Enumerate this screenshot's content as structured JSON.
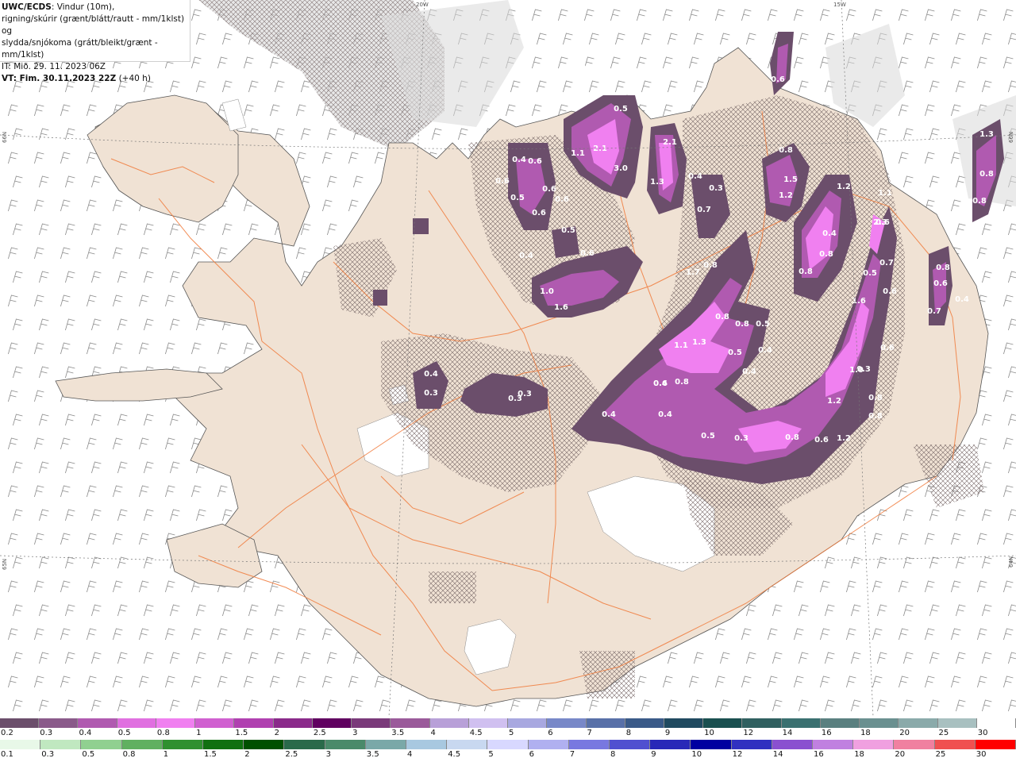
{
  "header": {
    "title_bold": "UWC/ECDS",
    "line1_rest": ": Vindur (10m),",
    "line2": "rigning/skúrir (grænt/blátt/rautt - mm/1klst) og",
    "line3": "slydda/snjókoma (grátt/bleikt/grænt - mm/1klst)",
    "init_time": "IT: Mið. 29. 11. 2023 06Z",
    "valid_bold": "VT: Fim. 30.11.2023 22Z",
    "valid_rest": " (+40 h)"
  },
  "graticule": {
    "lon_20w": "20W",
    "lon_15w": "15W",
    "lat_66n_left": "66N",
    "lat_66n_right": "66N",
    "lat_65n_left": "65N",
    "lat_64n_right": "64N"
  },
  "snow_scale": {
    "labels": [
      "0.2",
      "0.3",
      "0.4",
      "0.5",
      "0.8",
      "1",
      "1.5",
      "2",
      "2.5",
      "3",
      "3.5",
      "4",
      "4.5",
      "5",
      "6",
      "7",
      "8",
      "9",
      "10",
      "12",
      "14",
      "16",
      "18",
      "20",
      "25",
      "30"
    ],
    "colors": [
      "#6b4e6b",
      "#8a5a8a",
      "#b05ab0",
      "#e070e0",
      "#f080f0",
      "#d060d0",
      "#b040b0",
      "#8a2a8a",
      "#600060",
      "#7a3a7a",
      "#9a5a9a",
      "#b8a0d8",
      "#d0c0f0",
      "#a8a8e0",
      "#7888c8",
      "#5870a8",
      "#3a5a88",
      "#204a60",
      "#1a5050",
      "#306060",
      "#3a7070",
      "#5a8080",
      "#6a9090",
      "#8aaaaa",
      "#a8c0c0",
      "#ffffff"
    ]
  },
  "rain_scale": {
    "labels": [
      "0.1",
      "0.3",
      "0.5",
      "0.8",
      "1",
      "1.5",
      "2",
      "2.5",
      "3",
      "3.5",
      "4",
      "4.5",
      "5",
      "6",
      "7",
      "8",
      "9",
      "10",
      "12",
      "14",
      "16",
      "18",
      "20",
      "25",
      "30"
    ],
    "colors": [
      "#e8f8e8",
      "#c0e8c0",
      "#90d090",
      "#60b060",
      "#309030",
      "#107010",
      "#005000",
      "#2a6a4a",
      "#4a8a6a",
      "#7aa8a8",
      "#a8c8e0",
      "#c8d8f0",
      "#d8d8ff",
      "#b0b0f0",
      "#7878e0",
      "#5050d0",
      "#2828b8",
      "#0000a0",
      "#3030c0",
      "#8a50d0",
      "#c080e0",
      "#f0a0e0",
      "#f080a0",
      "#f05050",
      "#ff0000"
    ]
  },
  "precip_values": [
    "0.6",
    "0.5",
    "0.3",
    "1.3",
    "2.1",
    "1.1",
    "3.0",
    "2.1",
    "1.3",
    "0.4",
    "0.3",
    "0.7",
    "0.8",
    "1.5",
    "1.2",
    "1.2",
    "0.4",
    "0.6",
    "0.8",
    "0.8",
    "1.1",
    "0.8",
    "0.8",
    "0.4",
    "0.6",
    "0.6",
    "0.5",
    "0.6",
    "0.6",
    "0.6",
    "0.4",
    "0.5",
    "0.6",
    "1.7",
    "0.8",
    "0.7",
    "0.5",
    "0.8",
    "2.3",
    "0.6",
    "0.6",
    "0.4",
    "1.6",
    "1.0",
    "0.6",
    "0.7",
    "0.8",
    "0.8",
    "0.5",
    "0.4",
    "1.1",
    "1.3",
    "0.5",
    "0.4",
    "0.8",
    "0.6",
    "1.0",
    "1.6",
    "0.4",
    "0.3",
    "0.3",
    "0.3",
    "0.4",
    "0.4",
    "0.4",
    "0.5",
    "0.3",
    "0.8",
    "0.6",
    "1.2",
    "1.2",
    "0.8",
    "0.8",
    "0.3"
  ]
}
